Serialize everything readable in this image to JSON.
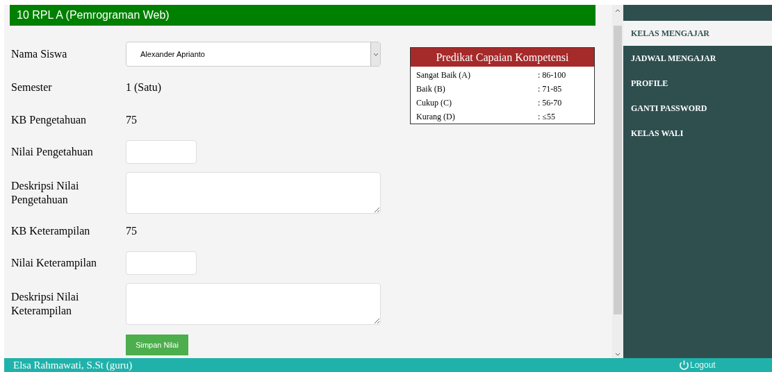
{
  "page_title": "10 RPL A (Pemrograman Web)",
  "form": {
    "student": {
      "label": "Nama Siswa",
      "value": "Alexander Aprianto"
    },
    "semester": {
      "label": "Semester",
      "value": "1 (Satu)"
    },
    "fields": [
      {
        "kind": "static",
        "label": "KB Pengetahuan",
        "value": "75"
      },
      {
        "kind": "input",
        "label": "Nilai Pengetahuan"
      },
      {
        "kind": "textarea",
        "label": "Deskripsi Nilai Pengetahuan"
      },
      {
        "kind": "static",
        "label": "KB Keterampilan",
        "value": "75"
      },
      {
        "kind": "input",
        "label": "Nilai Keterampilan"
      },
      {
        "kind": "textarea",
        "label": "Deskripsi Nilai Keterampilan"
      }
    ],
    "submit": "Simpan Nilai"
  },
  "legend": {
    "title": "Predikat Capaian Kompetensi",
    "rows": [
      {
        "grade": "Sangat Baik (A)",
        "range": ": 86-100"
      },
      {
        "grade": "Baik (B)",
        "range": ": 71-85"
      },
      {
        "grade": "Cukup (C)",
        "range": ": 56-70"
      },
      {
        "grade": "Kurang (D)",
        "range": ": ≤55"
      }
    ]
  },
  "sidebar": {
    "items": [
      {
        "label": "KELAS MENGAJAR",
        "selected": true
      },
      {
        "label": "JADWAL MENGAJAR",
        "selected": false
      },
      {
        "label": "PROFILE",
        "selected": false
      },
      {
        "label": "GANTI PASSWORD",
        "selected": false
      },
      {
        "label": "KELAS WALI",
        "selected": false
      }
    ]
  },
  "footer": {
    "user": "Elsa Rahmawati, S.St (guru)",
    "logout": "Logout"
  }
}
